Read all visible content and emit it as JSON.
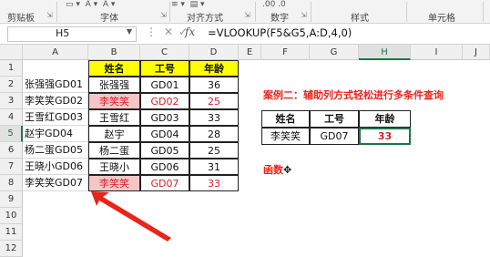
{
  "ribbon": {
    "groups": [
      "剪贴板",
      "字体",
      "对齐方式",
      "数字",
      "样式",
      "单元格"
    ]
  },
  "formula_bar": {
    "name_box": "H5",
    "fx": "fx",
    "formula": "=VLOOKUP(F5&G5,A:D,4,0)"
  },
  "columns": [
    "A",
    "B",
    "C",
    "D",
    "E",
    "F",
    "G",
    "H",
    "I",
    "J"
  ],
  "rows": [
    "1",
    "2",
    "3",
    "4",
    "5",
    "6",
    "7",
    "8",
    "9",
    "10",
    "11",
    "12"
  ],
  "table": {
    "headers": [
      "姓名",
      "工号",
      "年龄"
    ],
    "rows": [
      {
        "a": "张强强GD01",
        "b": "张强强",
        "c": "GD01",
        "d": "36"
      },
      {
        "a": "李笑笑GD02",
        "b": "李笑笑",
        "c": "GD02",
        "d": "25"
      },
      {
        "a": "王雪红GD03",
        "b": "王雪红",
        "c": "GD03",
        "d": "33"
      },
      {
        "a": "赵宇GD04",
        "b": "赵宇",
        "c": "GD04",
        "d": "28"
      },
      {
        "a": "杨二蛋GD05",
        "b": "杨二蛋",
        "c": "GD05",
        "d": "25"
      },
      {
        "a": "王晓小GD06",
        "b": "王晓小",
        "c": "GD06",
        "d": "31"
      },
      {
        "a": "李笑笑GD07",
        "b": "李笑笑",
        "c": "GD07",
        "d": "33"
      }
    ]
  },
  "case_title": "案例二：辅助列方式轻松进行多条件查询",
  "lookup": {
    "headers": [
      "姓名",
      "工号",
      "年龄"
    ],
    "values": [
      "李笑笑",
      "GD07",
      "33"
    ]
  },
  "func_label": "函数",
  "colors": {
    "yellow": "#ffff00",
    "pink": "#f4c6c6",
    "red": "#d9202b",
    "excel_green": "#217346"
  }
}
